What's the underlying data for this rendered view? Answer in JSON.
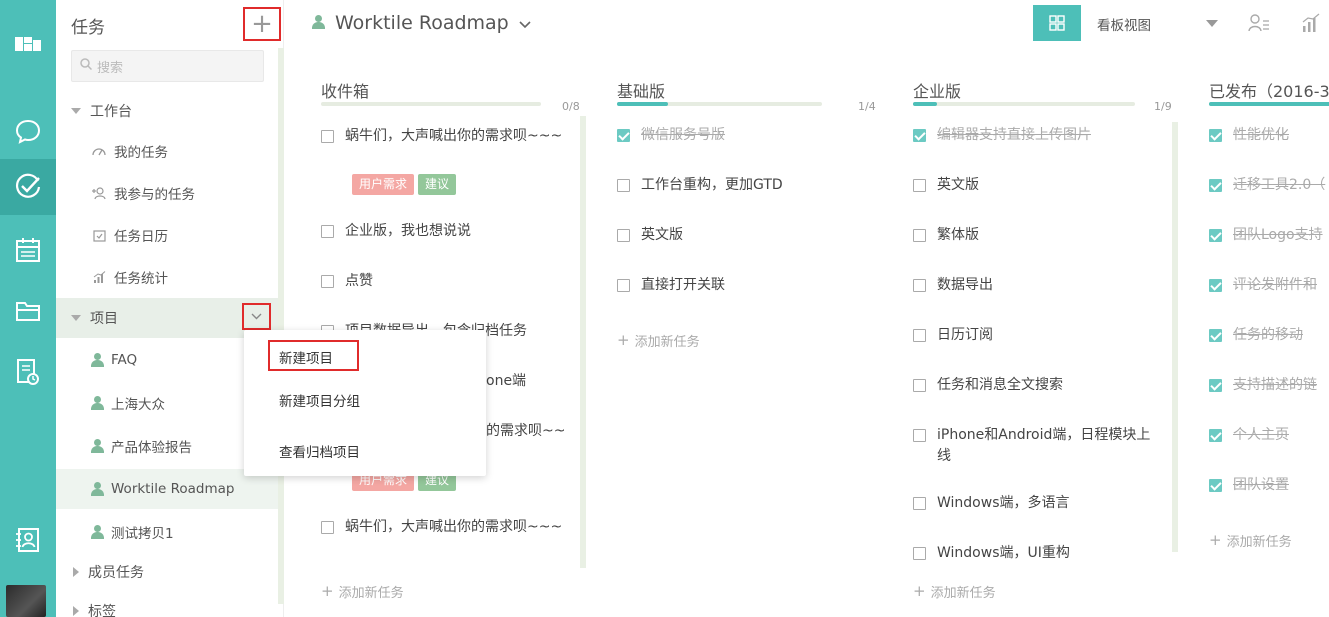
{
  "sidebar": {
    "title": "任务",
    "add_symbol": "+",
    "search_placeholder": "搜索",
    "workbench": "工作台",
    "my_tasks": "我的任务",
    "participated_tasks": "我参与的任务",
    "task_calendar": "任务日历",
    "task_stats": "任务统计",
    "projects": "项目",
    "project_items": [
      "FAQ",
      "上海大众",
      "产品体验报告",
      "Worktile Roadmap",
      "测试拷贝1"
    ],
    "member_tasks": "成员任务",
    "tags": "标签"
  },
  "menu": {
    "new_project": "新建项目",
    "new_project_group": "新建项目分组",
    "view_archived": "查看归档项目"
  },
  "header": {
    "project_name": "Worktile Roadmap",
    "view_label": "看板视图"
  },
  "columns": [
    {
      "title": "收件箱",
      "count": "0/8",
      "progress": 0,
      "tasks": [
        {
          "text": "蜗牛们，大声喊出你的需求呗~~~",
          "done": false,
          "tags": [
            "用户需求",
            "建议"
          ]
        },
        {
          "text": "企业版，我也想说说",
          "done": false
        },
        {
          "text": "点赞",
          "done": false
        },
        {
          "text": "项目数据导出，包含归档任务",
          "done": false
        },
        {
          "text": "one端",
          "done": false
        },
        {
          "text": "的需求呗~~",
          "done": false,
          "tags": [
            "用户需求",
            "建议"
          ]
        },
        {
          "text": "蜗牛们，大声喊出你的需求呗~~~",
          "done": false
        }
      ],
      "add_label": "添加新任务"
    },
    {
      "title": "基础版",
      "count": "1/4",
      "progress": 0.25,
      "tasks": [
        {
          "text": "微信服务号版",
          "done": true
        },
        {
          "text": "工作台重构，更加GTD",
          "done": false
        },
        {
          "text": "英文版",
          "done": false
        },
        {
          "text": "直接打开关联",
          "done": false
        }
      ],
      "add_label": "添加新任务"
    },
    {
      "title": "企业版",
      "count": "1/9",
      "progress": 0.11,
      "tasks": [
        {
          "text": "编辑器支持直接上传图片",
          "done": true
        },
        {
          "text": "英文版",
          "done": false
        },
        {
          "text": "繁体版",
          "done": false
        },
        {
          "text": "数据导出",
          "done": false
        },
        {
          "text": "日历订阅",
          "done": false
        },
        {
          "text": "任务和消息全文搜索",
          "done": false
        },
        {
          "text": "iPhone和Android端，日程模块上线",
          "done": false
        },
        {
          "text": "Windows端，多语言",
          "done": false
        },
        {
          "text": "Windows端，UI重构",
          "done": false
        }
      ],
      "add_label": "添加新任务"
    },
    {
      "title": "已发布（2016-3-",
      "progress": 1,
      "tasks": [
        {
          "text": "性能优化",
          "done": true
        },
        {
          "text": "迁移工具2.0（",
          "done": true
        },
        {
          "text": "团队Logo支持",
          "done": true
        },
        {
          "text": "评论发附件和",
          "done": true
        },
        {
          "text": "任务的移动",
          "done": true
        },
        {
          "text": "支持描述的链",
          "done": true
        },
        {
          "text": "个人主页",
          "done": true
        },
        {
          "text": "团队设置",
          "done": true
        }
      ],
      "add_label": "添加新任务"
    }
  ]
}
